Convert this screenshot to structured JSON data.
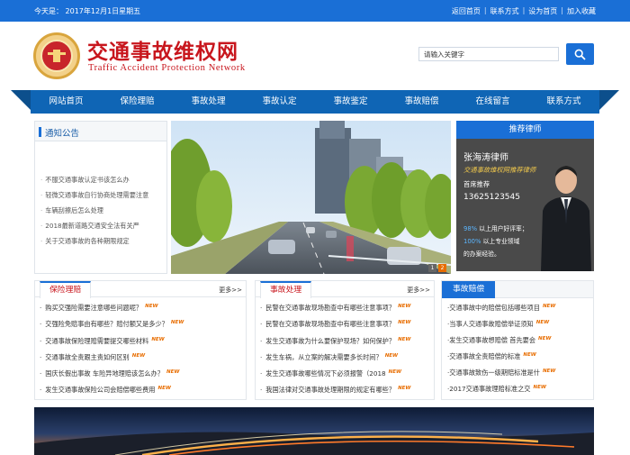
{
  "topbar": {
    "date": "今天是： 2017年12月1日星期五",
    "links": [
      "返回首页",
      "联系方式",
      "设为首页",
      "加入收藏"
    ]
  },
  "header": {
    "title": "交通事故维权网",
    "subtitle": "Traffic Accident Protection Network",
    "search_placeholder": "请输入关键字"
  },
  "nav": [
    "网站首页",
    "保险理赔",
    "事故处理",
    "事故认定",
    "事故鉴定",
    "事故赔偿",
    "在线留言",
    "联系方式"
  ],
  "notice": {
    "title": "通知公告",
    "items": [
      "不服交通事故认定书该怎么办",
      "轻微交通事故自行协商处理需要注意",
      "车辆刮擦后怎么处理",
      "2018最新道路交通安全法有关严",
      "关于交通事故的各种期限规定"
    ]
  },
  "lawyer": {
    "header": "推荐律师",
    "name": "张海涛律师",
    "title": "交通事故维权网推荐律师",
    "rec": "首席推荐",
    "phone": "13625123545",
    "stat1_value": "98%",
    "stat1_text": " 以上用户好评率；",
    "stat2_value": "100%",
    "stat2_text": " 以上专业领域",
    "stat3_text": "的办案经验。"
  },
  "banner": {
    "pager": [
      "1",
      "2"
    ]
  },
  "insurance": {
    "title": "保险理赔",
    "more": "更多>>",
    "items": [
      "购买交强险需要注意哪些问题呢？",
      "交强险免赔事由有哪些？赔付额又是多少？",
      "交通事故保险理赔需要提交哪些材料",
      "交通事故全责跟主责如何区别",
      "国庆长假出事故 车险异地理赔该怎么办？",
      "发生交通事故保险公司会赔偿哪些费用"
    ]
  },
  "handling": {
    "title": "事故处理",
    "more": "更多>>",
    "items": [
      "民警在交通事故现场勘查中有哪些注意事项？",
      "民警在交通事故现场勘查中有哪些注意事项？",
      "发生交通事故为什么要保护现场？如何保护？",
      "发生车祸，从立案的解决需要多长时间？",
      "发生交通事故哪些情况下必须报警（2018",
      "我国法律对交通事故处理期限的规定有哪些？"
    ]
  },
  "compensation": {
    "title": "事故赔偿",
    "items": [
      "交通事故中的赔偿包括哪些项目",
      "当事人交通事故赔偿举证须知",
      "发生交通事故想赔偿 首先要会",
      "交通事故全责赔偿的标准",
      "交通事故致伤一级期赔标准是什",
      "2017交通事故理赔标准之交"
    ]
  },
  "new_badge": "NEW",
  "colors": {
    "brand_blue": "#1a6fd6",
    "nav_blue": "#0f65b5",
    "title_red": "#c8161d",
    "badge_orange": "#e86d00"
  }
}
